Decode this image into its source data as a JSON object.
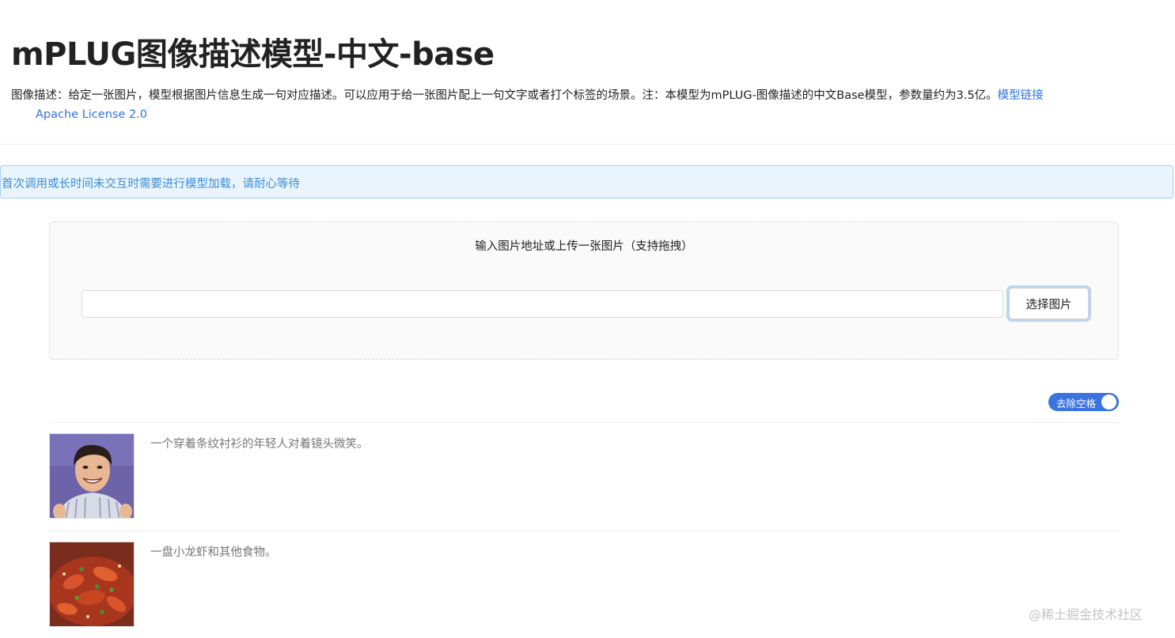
{
  "header": {
    "title": "mPLUG图像描述模型-中文-base",
    "description": "图像描述：给定一张图片，模型根据图片信息生成一句对应描述。可以应用于给一张图片配上一句文字或者打个标签的场景。注：本模型为mPLUG-图像描述的中文Base模型，参数量约为3.5亿。",
    "model_link": "模型链接",
    "license_link": "Apache License 2.0"
  },
  "notice": {
    "text": "首次调用或长时间未交互时需要进行模型加载，请耐心等待"
  },
  "upload": {
    "hint": "输入图片地址或上传一张图片（支持拖拽）",
    "url_value": "",
    "url_placeholder": "",
    "choose_button": "选择图片"
  },
  "toggle": {
    "label": "去除空格",
    "on": true
  },
  "results": [
    {
      "image": "young-man-smiling-photo",
      "caption": "一个穿着条纹衬衫的年轻人对着镜头微笑。"
    },
    {
      "image": "crayfish-dish-photo",
      "caption": "一盘小龙虾和其他食物。"
    }
  ],
  "watermark": "@稀土掘金技术社区",
  "colors": {
    "link": "#3273dc",
    "notice_bg": "#e9f4fd",
    "notice_text": "#3d8ed6",
    "toggle_bg": "#3b73e0"
  }
}
